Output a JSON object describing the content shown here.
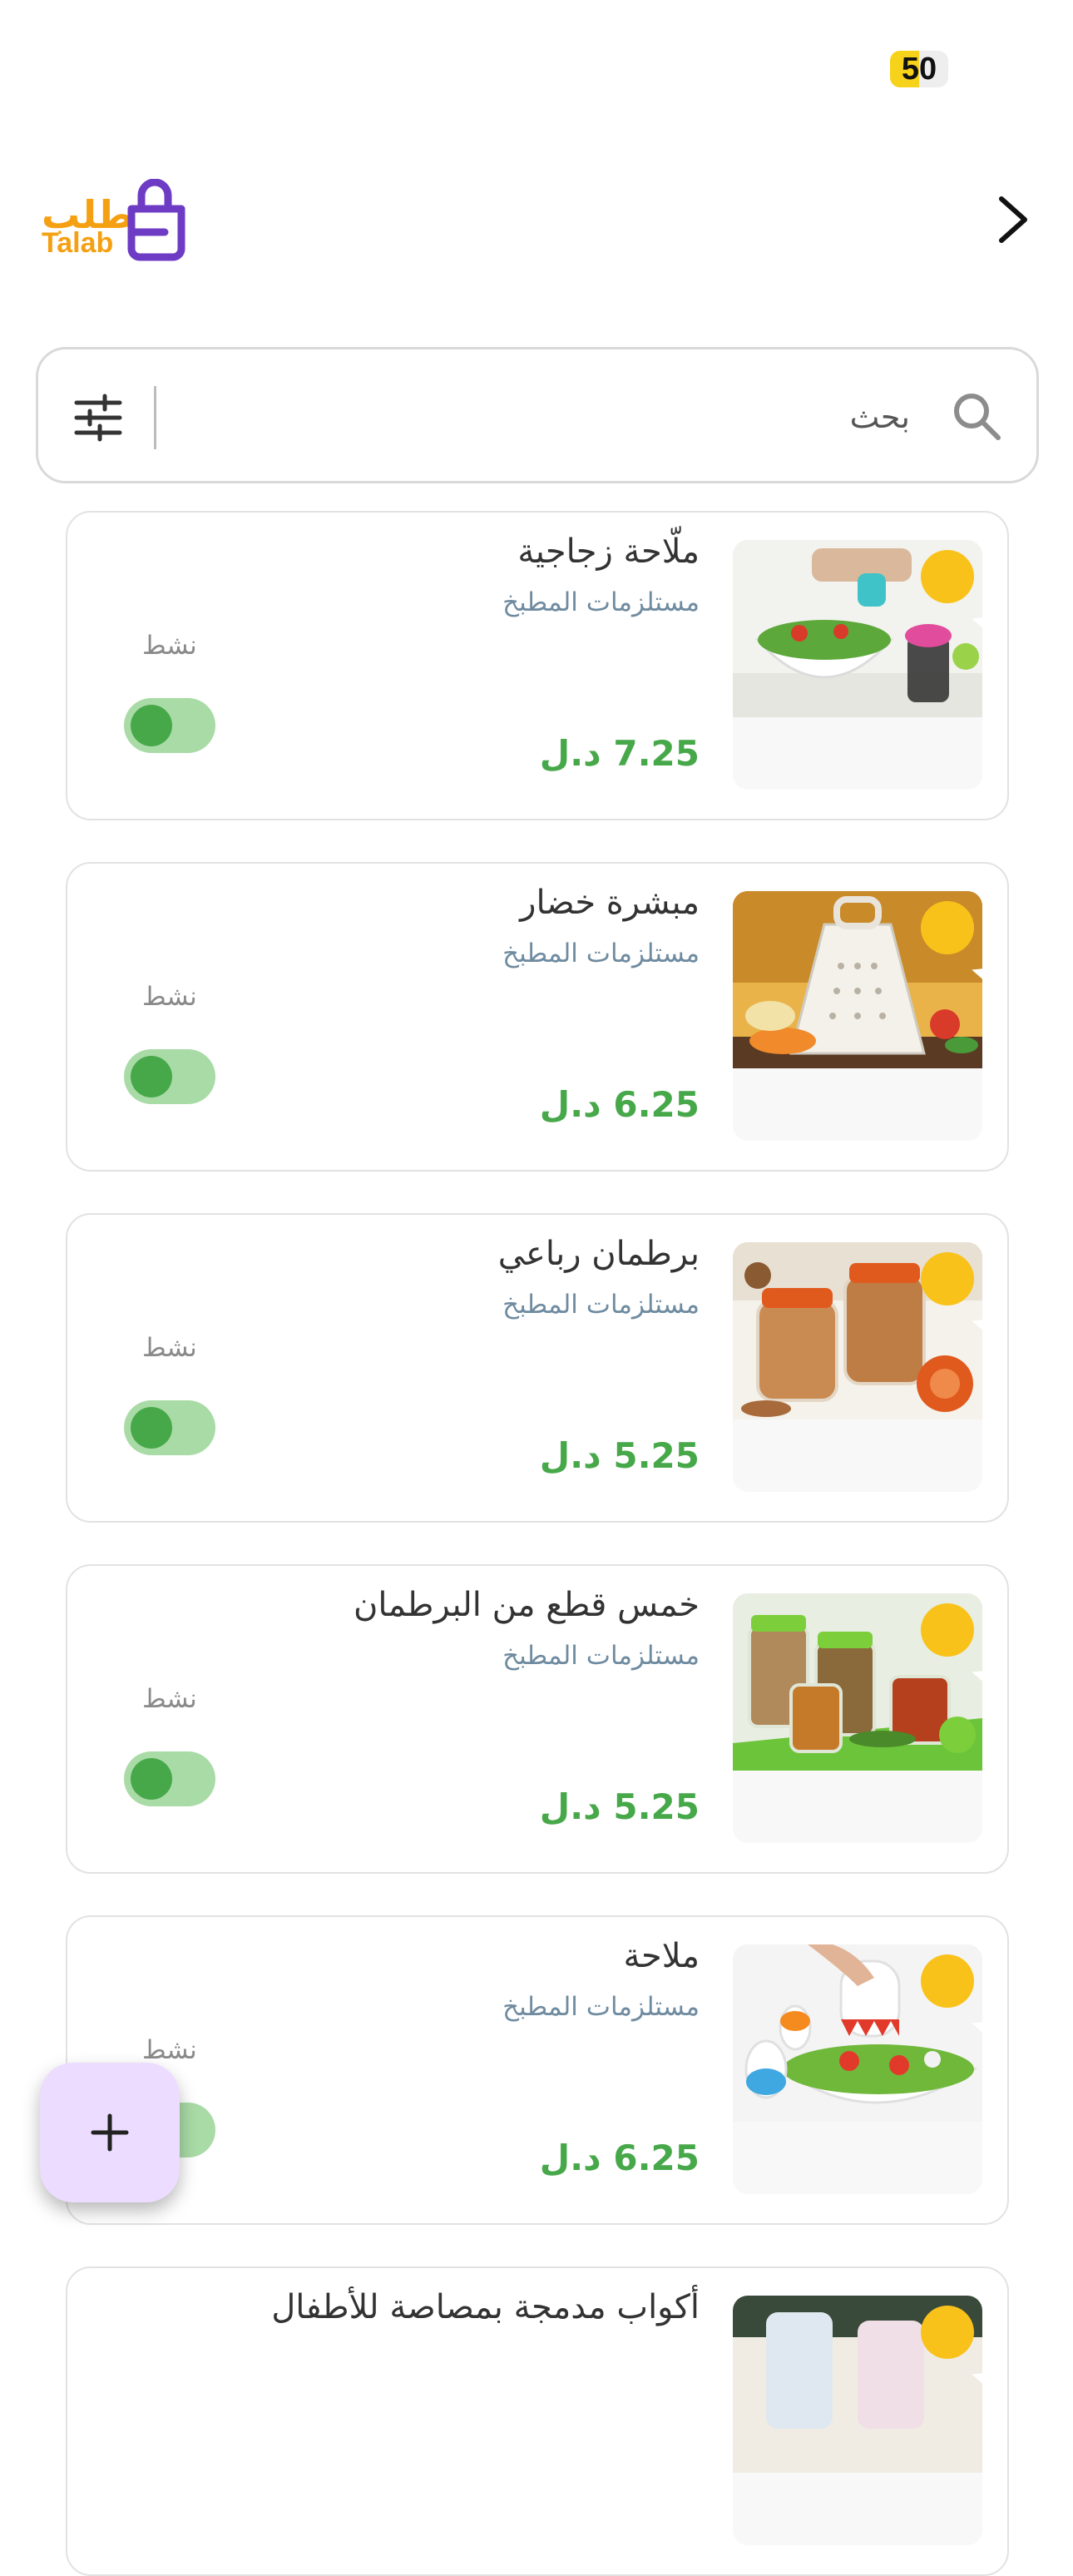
{
  "status_bar": {
    "battery": "50",
    "battery_level_percent": 50
  },
  "header": {
    "logo_ar": "طلب",
    "logo_en": "Talab"
  },
  "search": {
    "placeholder": "بحث"
  },
  "colors": {
    "accent_green": "#47a84a",
    "logo_orange": "#f5a013",
    "logo_purple": "#6e3cc4",
    "star_yellow": "#f9c21a",
    "fab_bg": "#ecdcff"
  },
  "products": [
    {
      "name": "ملّاحة زجاجية",
      "category": "مستلزمات المطبخ",
      "price": "7.25 د.ل",
      "status": "نشط",
      "active": true,
      "featured": true,
      "image_icon": "salt-shaker-salad-image"
    },
    {
      "name": "مبشرة خضار",
      "category": "مستلزمات المطبخ",
      "price": "6.25 د.ل",
      "status": "نشط",
      "active": true,
      "featured": true,
      "image_icon": "vegetable-grater-image"
    },
    {
      "name": "برطمان رباعي",
      "category": "مستلزمات المطبخ",
      "price": "5.25 د.ل",
      "status": "نشط",
      "active": true,
      "featured": true,
      "image_icon": "nut-jars-image"
    },
    {
      "name": "خمس قطع من البرطمان",
      "category": "مستلزمات المطبخ",
      "price": "5.25 د.ل",
      "status": "نشط",
      "active": true,
      "featured": true,
      "image_icon": "spice-jars-image"
    },
    {
      "name": "ملاحة",
      "category": "مستلزمات المطبخ",
      "price": "6.25 د.ل",
      "status": "نشط",
      "active": true,
      "featured": true,
      "image_icon": "salt-shaker-image"
    },
    {
      "name": "أكواب مدمجة بمصاصة للأطفال",
      "category": "",
      "price": "",
      "status": "",
      "active": true,
      "featured": true,
      "image_icon": "kids-cups-image"
    }
  ],
  "fab": {
    "icon": "plus-icon"
  }
}
